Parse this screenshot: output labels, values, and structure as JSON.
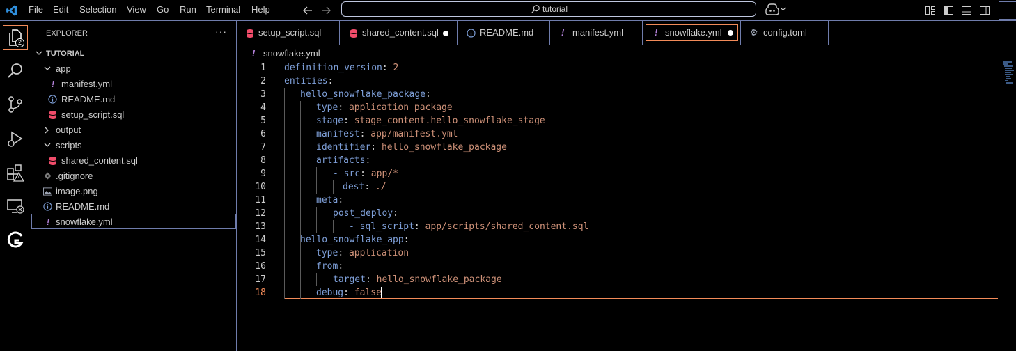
{
  "menu": [
    "File",
    "Edit",
    "Selection",
    "View",
    "Go",
    "Run",
    "Terminal",
    "Help"
  ],
  "search": {
    "label": "tutorial"
  },
  "explorer": {
    "title": "EXPLORER",
    "more": "···",
    "root": "TUTORIAL",
    "badge": "2",
    "items": [
      {
        "label": "app",
        "icon": "chevron-down"
      },
      {
        "label": "manifest.yml",
        "icon": "yaml"
      },
      {
        "label": "README.md",
        "icon": "info"
      },
      {
        "label": "setup_script.sql",
        "icon": "database"
      },
      {
        "label": "output",
        "icon": "chevron-right"
      },
      {
        "label": "scripts",
        "icon": "chevron-down"
      },
      {
        "label": "shared_content.sql",
        "icon": "database"
      },
      {
        "label": ".gitignore",
        "icon": "git"
      },
      {
        "label": "image.png",
        "icon": "image"
      },
      {
        "label": "README.md",
        "icon": "info"
      },
      {
        "label": "snowflake.yml",
        "icon": "yaml"
      }
    ]
  },
  "tabs": [
    {
      "label": "setup_script.sql",
      "icon": "database"
    },
    {
      "label": "shared_content.sql",
      "icon": "database",
      "dirty": true
    },
    {
      "label": "README.md",
      "icon": "info"
    },
    {
      "label": "manifest.yml",
      "icon": "yaml"
    },
    {
      "label": "snowflake.yml",
      "icon": "yaml",
      "dirty": true,
      "active": true
    },
    {
      "label": "config.toml",
      "icon": "gear"
    }
  ],
  "breadcrumb": {
    "file": "snowflake.yml"
  },
  "line_numbers": [
    "1",
    "2",
    "3",
    "4",
    "5",
    "6",
    "7",
    "8",
    "9",
    "10",
    "11",
    "12",
    "13",
    "14",
    "15",
    "16",
    "17",
    "18"
  ],
  "code": [
    {
      "key": "definition_version",
      "sep": ": ",
      "val": "2"
    },
    {
      "key": "entities",
      "sep": ":",
      "val": ""
    },
    {
      "key": "hello_snowflake_package",
      "sep": ":",
      "val": ""
    },
    {
      "key": "type",
      "sep": ": ",
      "val": "application package"
    },
    {
      "key": "stage",
      "sep": ": ",
      "val": "stage_content.hello_snowflake_stage"
    },
    {
      "key": "manifest",
      "sep": ": ",
      "val": "app/manifest.yml"
    },
    {
      "key": "identifier",
      "sep": ": ",
      "val": "hello_snowflake_package"
    },
    {
      "key": "artifacts",
      "sep": ":",
      "val": ""
    },
    {
      "key": "- src",
      "sep": ": ",
      "val": "app/*"
    },
    {
      "key": "dest",
      "sep": ": ",
      "val": "./"
    },
    {
      "key": "meta",
      "sep": ":",
      "val": ""
    },
    {
      "key": "post_deploy",
      "sep": ":",
      "val": ""
    },
    {
      "key": "- sql_script",
      "sep": ": ",
      "val": "app/scripts/shared_content.sql"
    },
    {
      "key": "hello_snowflake_app",
      "sep": ":",
      "val": ""
    },
    {
      "key": "type",
      "sep": ": ",
      "val": "application"
    },
    {
      "key": "from",
      "sep": ":",
      "val": ""
    },
    {
      "key": "target",
      "sep": ": ",
      "val": "hello_snowflake_package"
    },
    {
      "key": "debug",
      "sep": ": ",
      "val": "false"
    }
  ],
  "colors": {
    "accent": "#f38b59",
    "border": "#6f7cac",
    "key": "#7e9fd8",
    "value": "#ce9178",
    "bg": "#000000"
  }
}
